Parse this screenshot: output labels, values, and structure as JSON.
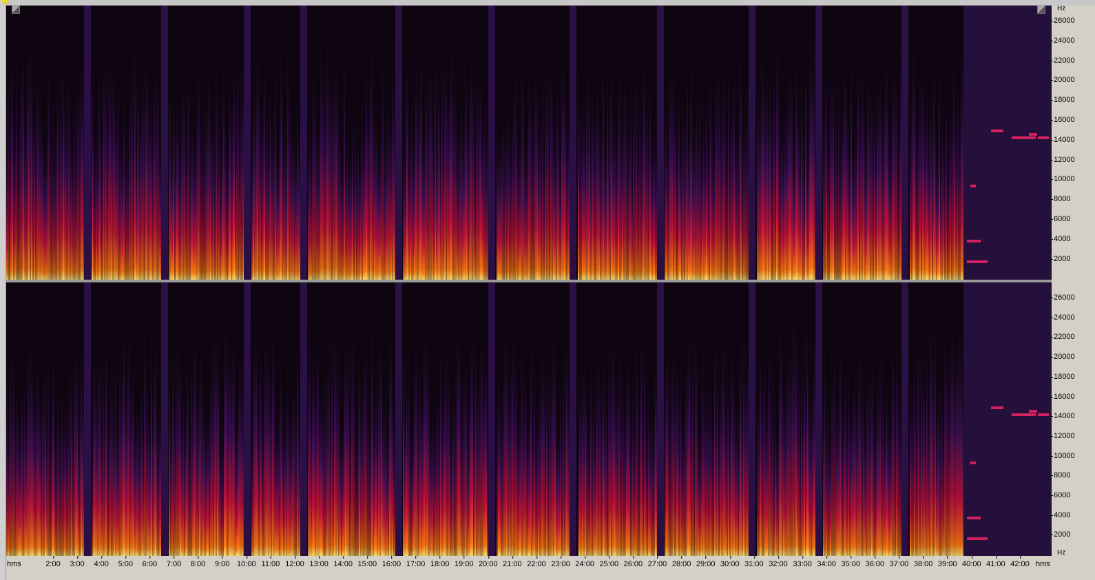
{
  "view": {
    "frequency_unit": "Hz",
    "time_unit": "hms",
    "left_marker_color": "#f2e000"
  },
  "channels": [
    {
      "name": "upper-channel",
      "y_ticks": [
        "26000",
        "24000",
        "22000",
        "20000",
        "18000",
        "16000",
        "14000",
        "12000",
        "10000",
        "8000",
        "6000",
        "4000",
        "2000"
      ]
    },
    {
      "name": "lower-channel",
      "y_ticks": [
        "26000",
        "24000",
        "22000",
        "20000",
        "18000",
        "16000",
        "14000",
        "12000",
        "10000",
        "8000",
        "6000",
        "4000",
        "2000"
      ]
    }
  ],
  "x_ticks": [
    "2:00",
    "3:00",
    "4:00",
    "5:00",
    "6:00",
    "7:00",
    "8:00",
    "9:00",
    "10:00",
    "11:00",
    "12:00",
    "13:00",
    "14:00",
    "15:00",
    "16:00",
    "17:00",
    "18:00",
    "19:00",
    "20:00",
    "21:00",
    "22:00",
    "23:00",
    "24:00",
    "25:00",
    "26:00",
    "27:00",
    "28:00",
    "29:00",
    "30:00",
    "31:00",
    "32:00",
    "33:00",
    "34:00",
    "35:00",
    "36:00",
    "37:00",
    "38:00",
    "39:00",
    "40:00",
    "41:00",
    "42:00"
  ],
  "icons": {
    "left_corner": "zoom-corner-icon",
    "right_corner": "zoom-corner-icon"
  },
  "colors": {
    "background": "#0e0510",
    "low": "#3a0f55",
    "mid": "#c4113a",
    "high": "#ff7a10",
    "peak": "#ffe070"
  }
}
